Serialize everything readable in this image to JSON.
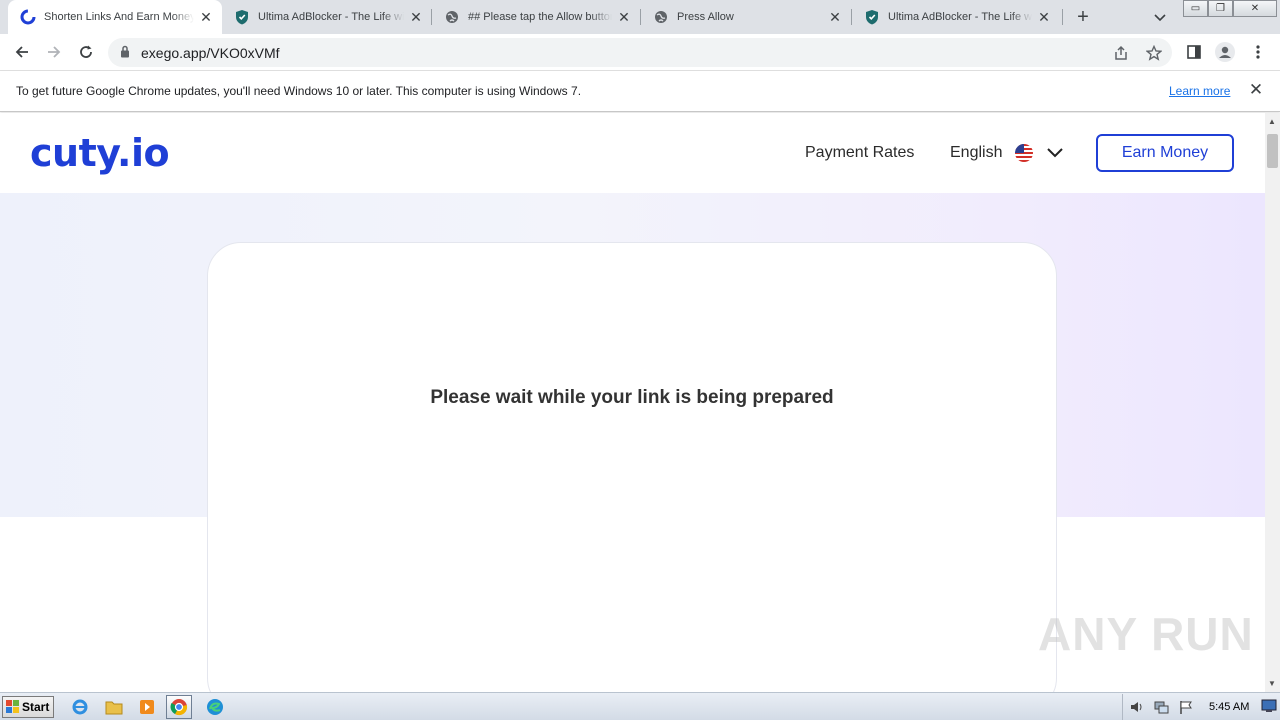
{
  "browser": {
    "tabs": [
      {
        "title": "Shorten Links And Earn Money",
        "icon": "cuty-icon",
        "active": true
      },
      {
        "title": "Ultima AdBlocker - The Life with",
        "icon": "shield-icon",
        "active": false
      },
      {
        "title": "## Please tap the Allow button",
        "icon": "globe-icon",
        "active": false
      },
      {
        "title": "Press Allow",
        "icon": "globe-icon",
        "active": false
      },
      {
        "title": "Ultima AdBlocker - The Life with",
        "icon": "shield-icon",
        "active": false
      }
    ],
    "url": "exego.app/VKO0xVMf"
  },
  "infobar": {
    "message": "To get future Google Chrome updates, you'll need Windows 10 or later. This computer is using Windows 7.",
    "link": "Learn more"
  },
  "site": {
    "logo": "cuty.io",
    "nav": {
      "payment_rates": "Payment Rates",
      "language": "English",
      "earn_money": "Earn Money"
    },
    "card": {
      "message": "Please wait while your link is being prepared"
    },
    "watermark": "ANY RUN"
  },
  "taskbar": {
    "start": "Start",
    "clock": "5:45 AM"
  },
  "colors": {
    "brand": "#1f3fd6",
    "tabstrip": "#dee1e6",
    "link": "#1a73e8"
  }
}
